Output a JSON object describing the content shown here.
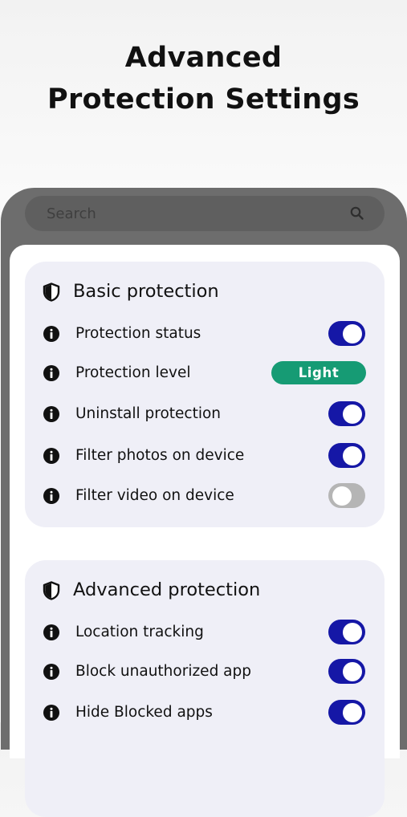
{
  "headline": {
    "line1": "Advanced",
    "line2": "Protection Settings"
  },
  "search": {
    "placeholder": "Search",
    "icon": "search-icon"
  },
  "colors": {
    "toggle_on": "#1517a6",
    "toggle_off": "#b5b5b5",
    "badge": "#169b74",
    "card_bg": "#efeff7",
    "frame": "#6d6d6d"
  },
  "sections": [
    {
      "title": "Basic protection",
      "icon": "shield-icon",
      "rows": [
        {
          "label": "Protection status",
          "control": "toggle",
          "on": true
        },
        {
          "label": "Protection level",
          "control": "badge",
          "value": "Light"
        },
        {
          "label": "Uninstall protection",
          "control": "toggle",
          "on": true
        },
        {
          "label": "Filter photos on device",
          "control": "toggle",
          "on": true
        },
        {
          "label": "Filter video on device",
          "control": "toggle",
          "on": false
        }
      ]
    },
    {
      "title": "Advanced protection",
      "icon": "shield-icon",
      "rows": [
        {
          "label": "Location tracking",
          "control": "toggle",
          "on": true
        },
        {
          "label": "Block unauthorized app",
          "control": "toggle",
          "on": true
        },
        {
          "label": "Hide Blocked apps",
          "control": "toggle",
          "on": true
        }
      ]
    }
  ]
}
